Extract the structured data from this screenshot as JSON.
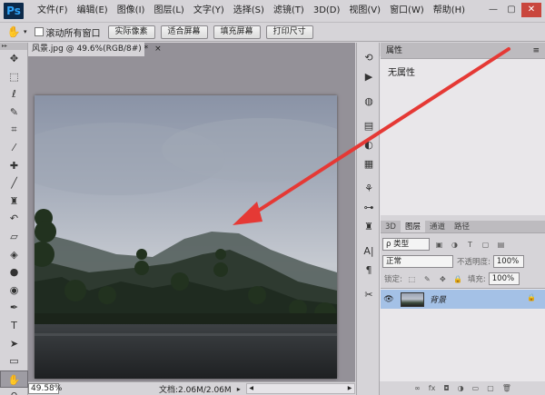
{
  "app": {
    "logo": "Ps"
  },
  "menubar": {
    "items": [
      "文件(F)",
      "编辑(E)",
      "图像(I)",
      "图层(L)",
      "文字(Y)",
      "选择(S)",
      "滤镜(T)",
      "3D(D)",
      "视图(V)",
      "窗口(W)",
      "帮助(H)"
    ],
    "window_controls": {
      "minimize": "—",
      "maximize": "▢",
      "close": "✕"
    }
  },
  "optionsbar": {
    "tool_icon": "hand-icon",
    "scroll_all_label": "滚动所有窗口",
    "scroll_all_checked": false,
    "buttons": [
      "实际像素",
      "适合屏幕",
      "填充屏幕",
      "打印尺寸"
    ]
  },
  "document": {
    "tab_title": "风景.jpg @ 49.6%(RGB/8#) *",
    "tab_close": "×"
  },
  "statusbar": {
    "zoom": "49.58%",
    "doc_info": "文档:2.06M/2.06M"
  },
  "properties_panel": {
    "header": "属性",
    "body_text": "无属性"
  },
  "layers_panel": {
    "tabs": [
      "3D",
      "图层",
      "通道",
      "路径"
    ],
    "active_tab": "图层",
    "filter_label": "ρ 类型",
    "blend_mode": "正常",
    "opacity_label": "不透明度:",
    "opacity_value": "100%",
    "lock_label": "锁定:",
    "fill_label": "填充:",
    "fill_value": "100%",
    "layers": [
      {
        "name": "背景",
        "visible": true,
        "locked": true,
        "selected": true
      }
    ]
  },
  "colors": {
    "ui_bg": "#d6d4d8",
    "workspace": "#949198",
    "selected_layer": "#a4c1e6",
    "annotation_arrow": "#e53935"
  }
}
